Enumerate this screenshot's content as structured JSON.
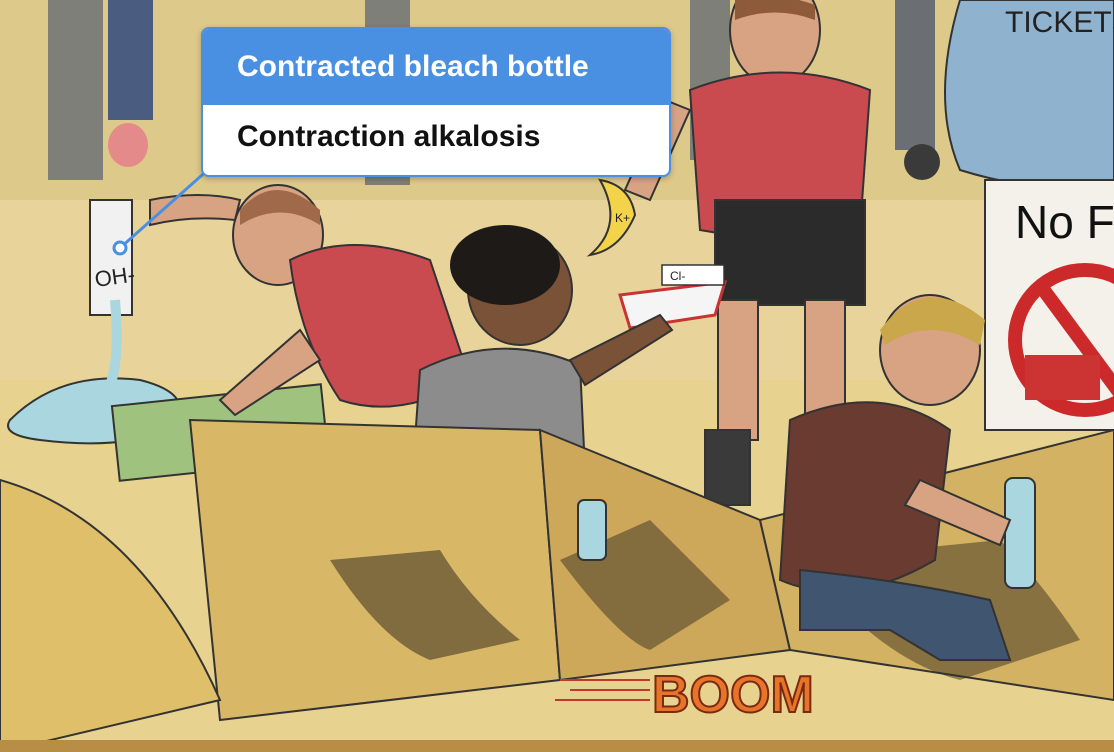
{
  "popup": {
    "title": "Contracted bleach bottle",
    "description": "Contraction alkalosis"
  },
  "scene_text": {
    "bottle_label": "OH-",
    "tickets_sign": "TICKETS",
    "no_food_sign": "No Fo",
    "ion_label_cl": "Cl-",
    "ion_label_k": "K+",
    "sound_effect": "BOOM"
  },
  "colors": {
    "popup_accent": "#4a90e2",
    "popup_text": "#111111"
  }
}
